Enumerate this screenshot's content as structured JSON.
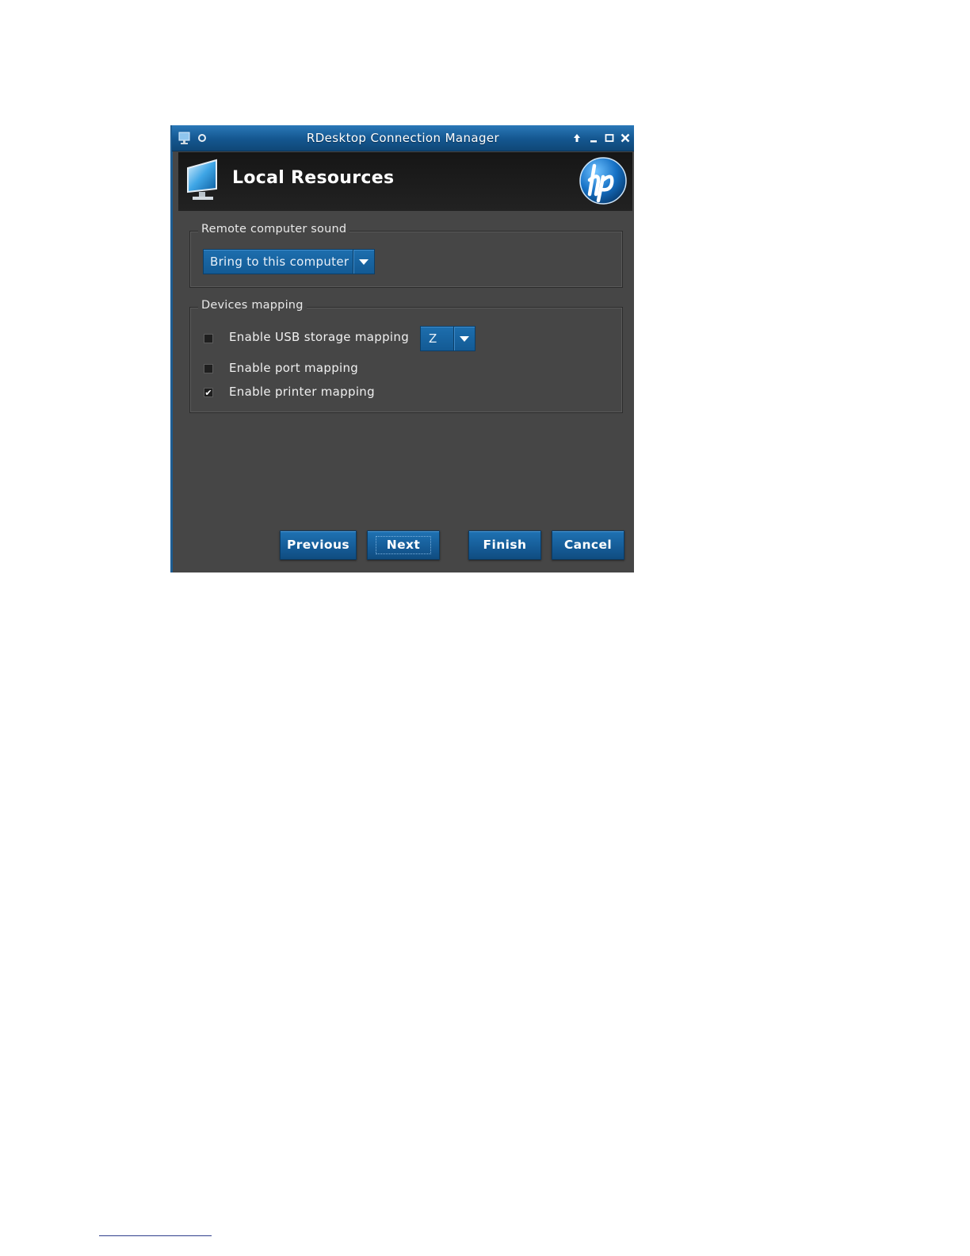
{
  "window": {
    "title": "RDesktop Connection Manager"
  },
  "header": {
    "title": "Local Resources"
  },
  "sound_group": {
    "label": "Remote computer sound",
    "selected": "Bring to this computer"
  },
  "devices_group": {
    "label": "Devices mapping",
    "usb": {
      "label": "Enable USB storage mapping",
      "checked": false,
      "drive": "Z"
    },
    "port": {
      "label": "Enable port mapping",
      "checked": false
    },
    "printer": {
      "label": "Enable printer mapping",
      "checked": true,
      "mark": "✔"
    }
  },
  "buttons": {
    "previous": "Previous",
    "next": "Next",
    "finish": "Finish",
    "cancel": "Cancel"
  },
  "colors": {
    "accent": "#155b96",
    "panel": "#464646",
    "header": "#1b1b1b"
  }
}
